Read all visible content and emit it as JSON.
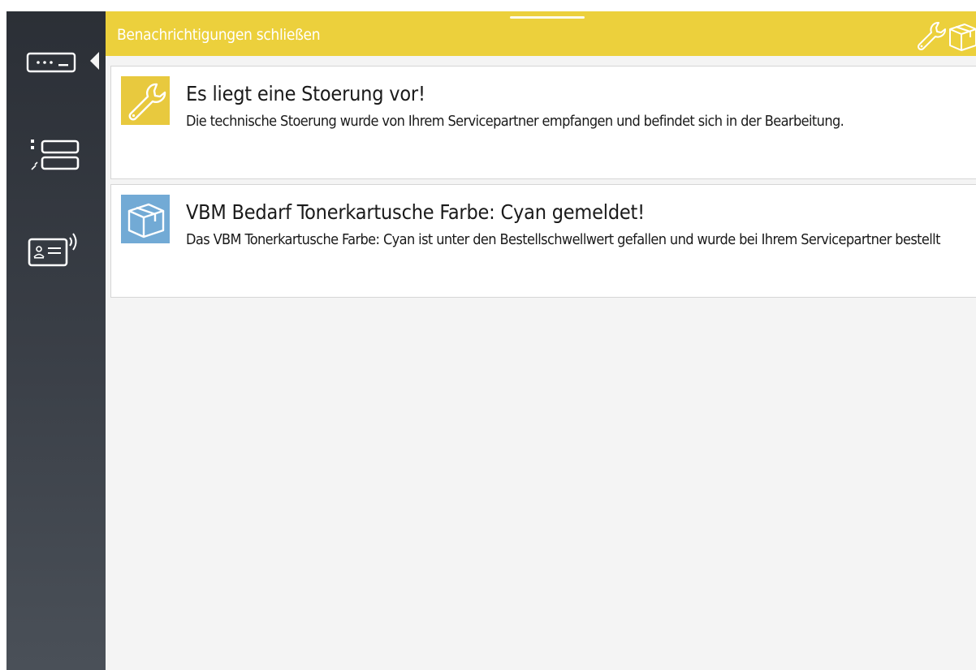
{
  "header": {
    "close_label": "Benachrichtigungen schließen",
    "background_color": "#ecd03c",
    "icons": [
      "wrench-icon",
      "box-icon"
    ]
  },
  "sidebar": {
    "items": [
      {
        "name": "sidebar-item-keyboard",
        "icon": "keyboard-icon",
        "selected": true
      },
      {
        "name": "sidebar-item-service-list",
        "icon": "service-list-icon",
        "selected": false
      },
      {
        "name": "sidebar-item-contactless-card",
        "icon": "contactless-card-icon",
        "selected": false
      }
    ]
  },
  "notifications": [
    {
      "icon": "wrench-icon",
      "icon_color": "#e8c93e",
      "title": "Es liegt eine Stoerung vor!",
      "text": "Die technische Stoerung wurde von Ihrem Servicepartner empfangen und befindet sich in der Bearbeitung."
    },
    {
      "icon": "box-icon",
      "icon_color": "#72aad5",
      "title": "VBM Bedarf Tonerkartusche Farbe: Cyan gemeldet!",
      "text": "Das VBM Tonerkartusche Farbe: Cyan ist unter den Bestellschwellwert gefallen und wurde bei Ihrem Servicepartner bestellt"
    }
  ]
}
